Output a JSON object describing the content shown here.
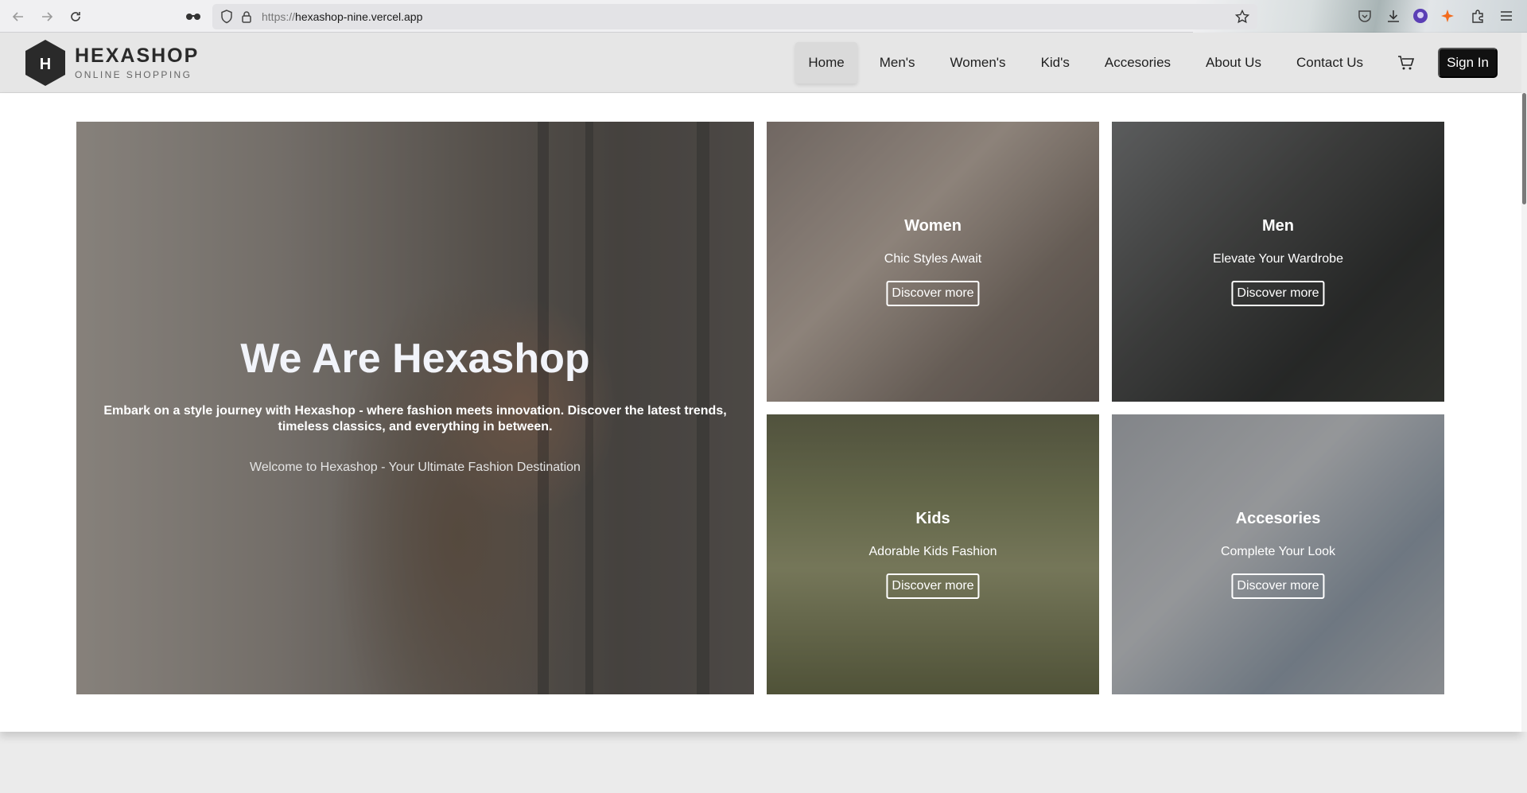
{
  "browser": {
    "url_proto": "https://",
    "url_host": "hexashop-nine.vercel.app"
  },
  "header": {
    "brand_name": "HEXASHOP",
    "brand_tagline": "ONLINE SHOPPING",
    "logo_letter": "H",
    "nav": [
      "Home",
      "Men's",
      "Women's",
      "Kid's",
      "Accesories",
      "About Us",
      "Contact Us"
    ],
    "active_nav": "Home",
    "sign_in": "Sign In"
  },
  "hero": {
    "title": "We Are Hexashop",
    "description": "Embark on a style journey with Hexashop - where fashion meets innovation. Discover the latest trends, timeless classics, and everything in between.",
    "welcome": "Welcome to Hexashop - Your Ultimate Fashion Destination"
  },
  "categories": [
    {
      "title": "Women",
      "subtitle": "Chic Styles Await",
      "button": "Discover more"
    },
    {
      "title": "Men",
      "subtitle": "Elevate Your Wardrobe",
      "button": "Discover more"
    },
    {
      "title": "Kids",
      "subtitle": "Adorable Kids Fashion",
      "button": "Discover more"
    },
    {
      "title": "Accesories",
      "subtitle": "Complete Your Look",
      "button": "Discover more"
    }
  ]
}
